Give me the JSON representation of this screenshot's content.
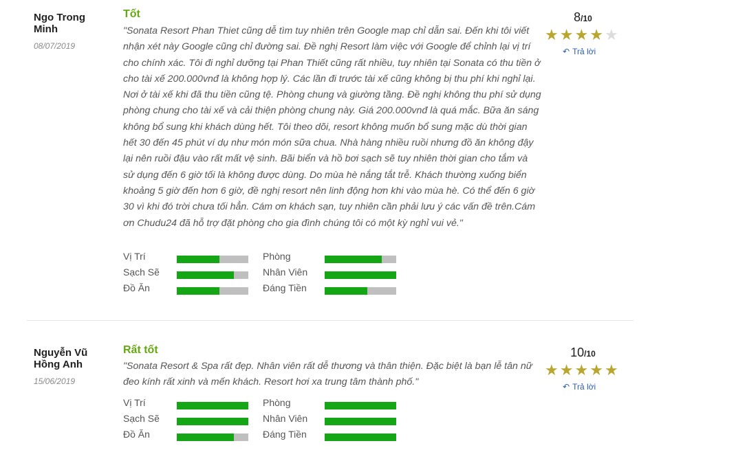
{
  "reviews": [
    {
      "author": "Ngo Trong Minh",
      "date": "08/07/2019",
      "title": "Tốt",
      "text": "\"Sonata Resort Phan Thiet cũng dễ tìm tuy nhiên trên Google map chỉ dẫn sai. Đến khi tôi viết nhận xét này Google cũng chỉ đường sai. Đề nghị Resort làm việc với Google để chỉnh lại vị trí cho chính xác. Tôi đi nghỉ dưỡng tại Phan Thiết cũng rất nhiều, tuy nhiên tại Sonata có thu tiền ở cho tài xế 200.000vnđ là không hợp lý. Các lần đi trước tài xế cũng không bị thu phí khi nghỉ lại. Nơi ở tài xế khi đã thu tiền cũng tệ. Phòng chung và giường tầng. Đề nghị không thu phí sử dụng phòng chung cho tài xế và cải thiện phòng chung này. Giá 200.000vnđ là quá mắc. Bữa ăn sáng không bổ sung khi khách dùng hết. Tôi theo dõi, resort không muốn bổ sung mặc dù thời gian hết 30 đến 45 phút ví dụ như món món sữa chua. Nhà hàng nhiều ruồi nhưng đồ ăn không đậy lại nên ruồi đậu vào rất mất vệ sinh. Bãi biển và hồ bơi sạch sẽ tuy nhiên thời gian cho tắm và sử dụng đến 6 giờ tối là không được dùng. Do mùa hè nắng tắt trễ. Khách thường xuống biển khoảng 5 giờ đến hơn 6 giờ, đề nghị resort nên linh động hơn khi vào mùa hè. Có thể đến 6 giờ 30 vì khi đó trời chưa tối hẳn. Cám ơn khách sạn, tuy nhiên cần phải lưu ý các vấn đề trên.Cám ơn Chudu24 đã hỗ trợ đặt phòng cho gia đình chúng tôi có một kỳ nghỉ vui vẻ.\"",
      "score": "8",
      "score_max": "/10",
      "stars": 4,
      "reply_label": "Trả lời",
      "criteria": [
        {
          "label": "Vị Trí",
          "value": 0.6
        },
        {
          "label": "Sạch Sẽ",
          "value": 0.8
        },
        {
          "label": "Đồ Ăn",
          "value": 0.6
        },
        {
          "label": "Phòng",
          "value": 0.8
        },
        {
          "label": "Nhân Viên",
          "value": 1.0
        },
        {
          "label": "Đáng Tiền",
          "value": 0.6
        }
      ]
    },
    {
      "author": "Nguyễn Vũ Hồng Anh",
      "date": "15/06/2019",
      "title": "Rất tốt",
      "text": "\"Sonata Resort & Spa rất đẹp. Nhân viên rất dễ thương và thân thiện. Đặc biệt là bạn lễ tân nữ đeo kính rất xinh và mến khách. Resort hơi xa trung tâm thành phố.\"",
      "score": "10",
      "score_max": "/10",
      "stars": 5,
      "reply_label": "Trả lời",
      "criteria": [
        {
          "label": "Vị Trí",
          "value": 1.0
        },
        {
          "label": "Sạch Sẽ",
          "value": 1.0
        },
        {
          "label": "Đồ Ăn",
          "value": 0.8
        },
        {
          "label": "Phòng",
          "value": 1.0
        },
        {
          "label": "Nhân Viên",
          "value": 1.0
        },
        {
          "label": "Đáng Tiền",
          "value": 1.0
        }
      ]
    }
  ],
  "colors": {
    "accent_green": "#66a80f",
    "bar_fill": "#14a614",
    "bar_bg": "#bfbfbf",
    "star": "#b9a630",
    "reply": "#2b5ca8"
  },
  "icons": {
    "star": "star-icon",
    "reply": "reply-arrow-icon"
  }
}
